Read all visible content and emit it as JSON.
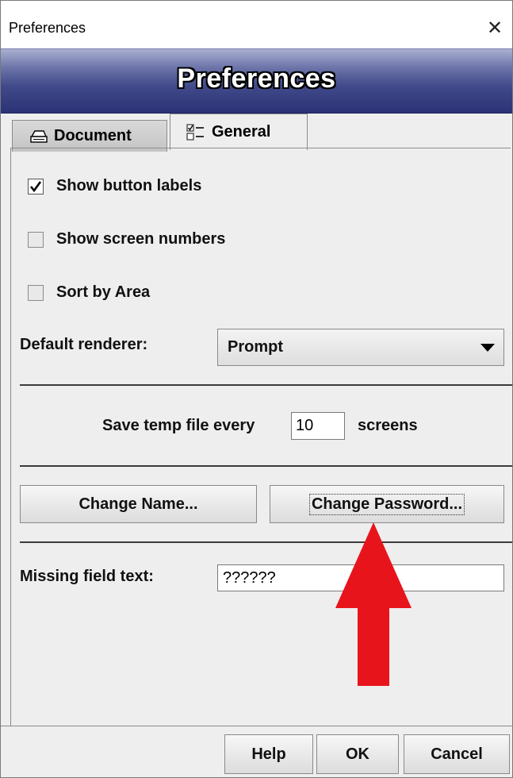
{
  "window": {
    "title": "Preferences",
    "close_glyph": "✕"
  },
  "banner": {
    "title": "Preferences"
  },
  "tabs": [
    {
      "label": "Document",
      "icon": "printer-icon",
      "selected": false
    },
    {
      "label": "General",
      "icon": "list-icon",
      "selected": true
    }
  ],
  "options": {
    "show_button_labels": {
      "label": "Show button labels",
      "checked": true
    },
    "show_screen_numbers": {
      "label": "Show screen numbers",
      "checked": false
    },
    "sort_by_area": {
      "label": "Sort by Area",
      "checked": false
    }
  },
  "renderer": {
    "label": "Default renderer:",
    "value": "Prompt"
  },
  "temp_file": {
    "prefix": "Save temp file every",
    "value": "10",
    "suffix": "screens"
  },
  "buttons": {
    "change_name": "Change Name...",
    "change_password": "Change Password..."
  },
  "missing_field": {
    "label": "Missing field text:",
    "value": "??????"
  },
  "footer": {
    "help": "Help",
    "ok": "OK",
    "cancel": "Cancel"
  },
  "colors": {
    "banner_dark": "#2b3376",
    "annotation_arrow": "#e8141c"
  }
}
